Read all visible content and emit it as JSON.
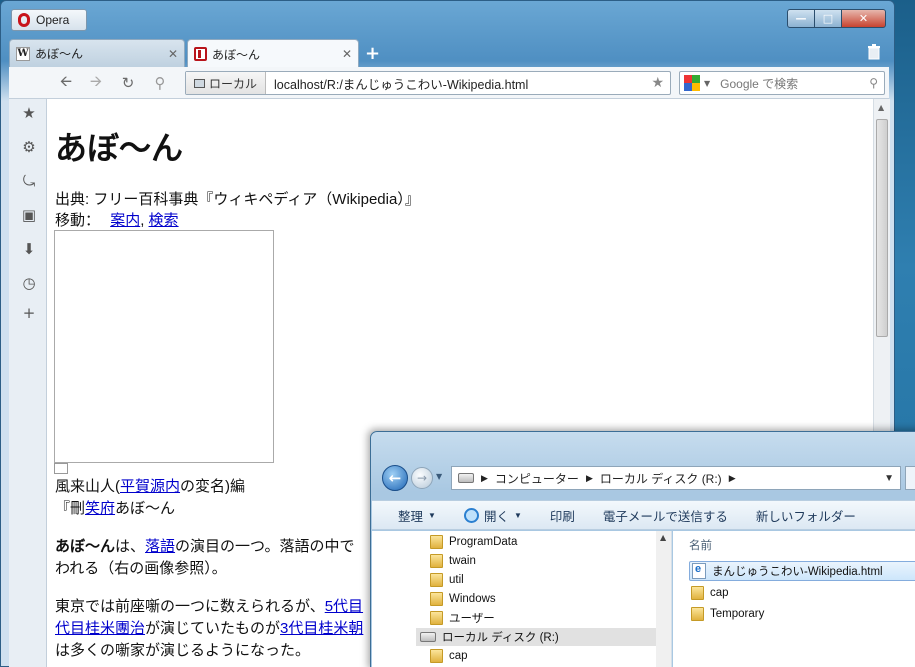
{
  "opera": {
    "menu_label": "Opera",
    "tabs": [
      {
        "label": "あぼ〜ん",
        "active": false
      },
      {
        "label": "あぼ〜ん",
        "active": true
      }
    ],
    "new_tab": "+",
    "address": {
      "badge": "ローカル",
      "url": "localhost/R:/まんじゅうこわい-Wikipedia.html"
    },
    "search_placeholder": "Google で検索",
    "icons": {
      "back": "back-arrow-icon",
      "forward": "forward-arrow-icon",
      "reload": "reload-icon",
      "key": "key-icon"
    }
  },
  "page": {
    "title": "あぼ〜ん",
    "source_line": "出典: フリー百科事典『ウィキペディア（Wikipedia）』",
    "nav_prefix": "移動：",
    "nav_links": [
      "案内",
      "検索"
    ],
    "caption_prefix": "風来山人(",
    "caption_link": "平賀源内",
    "caption_suffix": "の変名)編",
    "caption2_prefix": "『刪",
    "caption2_link": "笑府",
    "caption2_suffix": "あぼ〜ん",
    "para1_bold": "あぼ〜ん",
    "para1_mid": "は、",
    "para1_link": "落語",
    "para1_rest": "の演目の一つ。落語の中で",
    "para1_line2": "われる（右の画像参照）。",
    "para2_line1_text": "東京では前座噺の一つに数えられるが、",
    "para2_line1_link": "5代目",
    "para2_line2_link1": "代目桂米團治",
    "para2_line2_mid": "が演じていたものが",
    "para2_line2_link2": "3代目桂米朝",
    "para2_line3": "は多くの噺家が演じるようになった。"
  },
  "explorer": {
    "breadcrumb": [
      "コンピューター",
      "ローカル ディスク (R:)"
    ],
    "commands": [
      "整理",
      "開く",
      "印刷",
      "電子メールで送信する",
      "新しいフォルダー"
    ],
    "tree": [
      "ProgramData",
      "twain",
      "util",
      "Windows",
      "ユーザー",
      "ローカル ディスク (R:)",
      "cap"
    ],
    "column_name": "名前",
    "files": [
      "まんじゅうこわい-Wikipedia.html",
      "cap",
      "Temporary"
    ]
  }
}
